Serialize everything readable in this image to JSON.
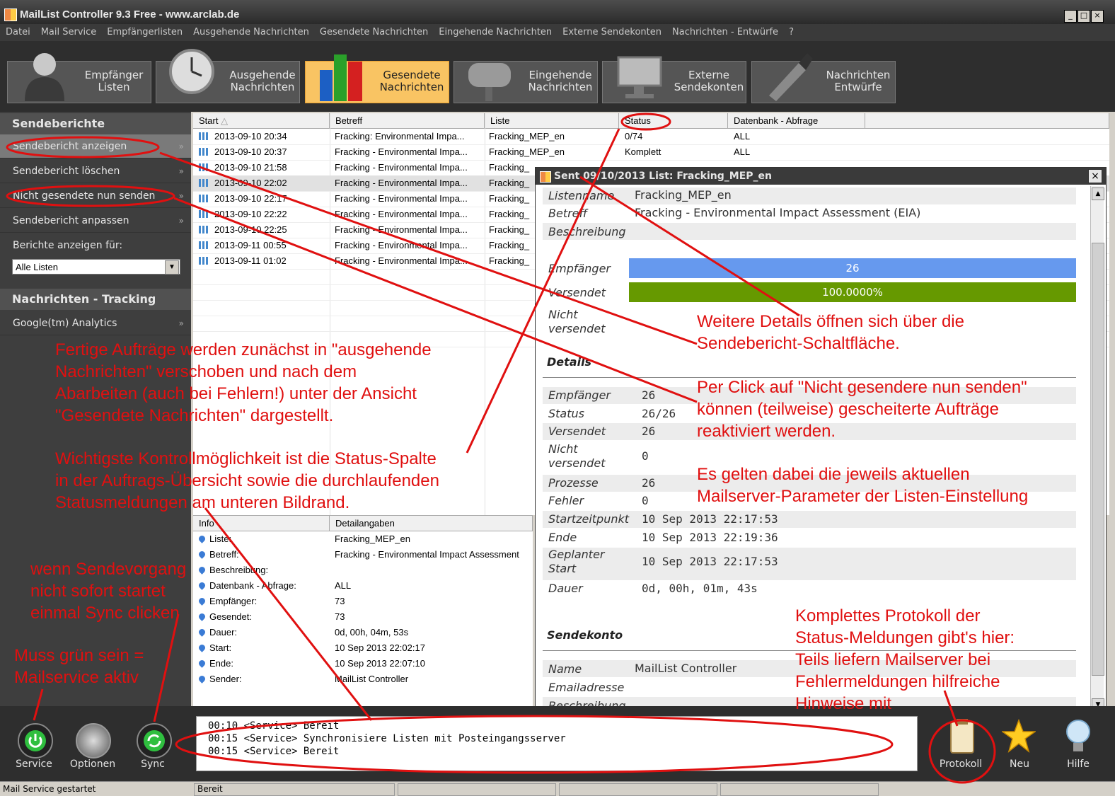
{
  "window": {
    "title": "MailList Controller 9.3 Free - www.arclab.de",
    "btn_min": "_",
    "btn_max": "□",
    "btn_close": "×"
  },
  "menu": [
    "Datei",
    "Mail Service",
    "Empfängerlisten",
    "Ausgehende Nachrichten",
    "Gesendete Nachrichten",
    "Eingehende Nachrichten",
    "Externe Sendekonten",
    "Nachrichten - Entwürfe",
    "?"
  ],
  "toolbar": [
    {
      "line1": "Empfänger",
      "line2": "Listen"
    },
    {
      "line1": "Ausgehende",
      "line2": "Nachrichten"
    },
    {
      "line1": "Gesendete",
      "line2": "Nachrichten",
      "active": true
    },
    {
      "line1": "Eingehende",
      "line2": "Nachrichten"
    },
    {
      "line1": "Externe",
      "line2": "Sendekonten"
    },
    {
      "line1": "Nachrichten",
      "line2": "Entwürfe"
    }
  ],
  "sidebar": {
    "section1": "Sendeberichte",
    "items": [
      "Sendebericht anzeigen",
      "Sendebericht löschen",
      "Nicht gesendete nun senden",
      "Sendebericht anpassen"
    ],
    "arrow": "»",
    "filter_label": "Berichte anzeigen für:",
    "filter_value": "Alle Listen",
    "section2": "Nachrichten - Tracking",
    "tracking_item": "Google(tm) Analytics"
  },
  "grid": {
    "headers": [
      "Start",
      "Betreff",
      "Liste",
      "Status",
      "Datenbank - Abfrage"
    ],
    "sort_indicator": "△",
    "rows": [
      {
        "start": "2013-09-10 20:34",
        "betreff": "Fracking: Environmental Impa...",
        "liste": "Fracking_MEP_en",
        "status": "0/74",
        "db": "ALL"
      },
      {
        "start": "2013-09-10 20:37",
        "betreff": "Fracking - Environmental Impa...",
        "liste": "Fracking_MEP_en",
        "status": "Komplett",
        "db": "ALL"
      },
      {
        "start": "2013-09-10 21:58",
        "betreff": "Fracking - Environmental Impa...",
        "liste": "Fracking_",
        "status": "",
        "db": ""
      },
      {
        "start": "2013-09-10 22:02",
        "betreff": "Fracking - Environmental Impa...",
        "liste": "Fracking_",
        "status": "",
        "db": ""
      },
      {
        "start": "2013-09-10 22:17",
        "betreff": "Fracking - Environmental Impa...",
        "liste": "Fracking_",
        "status": "",
        "db": ""
      },
      {
        "start": "2013-09-10 22:22",
        "betreff": "Fracking - Environmental Impa...",
        "liste": "Fracking_",
        "status": "",
        "db": ""
      },
      {
        "start": "2013-09-10 22:25",
        "betreff": "Fracking - Environmental Impa...",
        "liste": "Fracking_",
        "status": "",
        "db": ""
      },
      {
        "start": "2013-09-11 00:55",
        "betreff": "Fracking - Environmental Impa...",
        "liste": "Fracking_",
        "status": "",
        "db": ""
      },
      {
        "start": "2013-09-11 01:02",
        "betreff": "Fracking - Environmental Impa...",
        "liste": "Fracking_",
        "status": "",
        "db": ""
      }
    ],
    "selected_row": 3
  },
  "info": {
    "headers": [
      "Info",
      "Detailangaben"
    ],
    "rows": [
      {
        "k": "Liste:",
        "v": "Fracking_MEP_en"
      },
      {
        "k": "Betreff:",
        "v": "Fracking - Environmental Impact Assessment"
      },
      {
        "k": "Beschreibung:",
        "v": ""
      },
      {
        "k": "Datenbank - Abfrage:",
        "v": "ALL"
      },
      {
        "k": "Empfänger:",
        "v": "73"
      },
      {
        "k": "Gesendet:",
        "v": "73"
      },
      {
        "k": "Dauer:",
        "v": "0d, 00h, 04m, 53s"
      },
      {
        "k": "Start:",
        "v": "10 Sep 2013 22:02:17"
      },
      {
        "k": "Ende:",
        "v": "10 Sep 2013 22:07:10"
      },
      {
        "k": "Sender:",
        "v": "MailList Controller"
      }
    ]
  },
  "popup": {
    "title": "Sent 09/10/2013 List: Fracking_MEP_en",
    "close": "×",
    "listenname_k": "Listenname",
    "listenname_v": "Fracking_MEP_en",
    "betreff_k": "Betreff",
    "betreff_v": "Fracking - Environmental Impact Assessment (EIA)",
    "beschreibung_k": "Beschreibung",
    "empf_bar_k": "Empfänger",
    "empf_bar_v": "26",
    "vers_bar_k": "Versendet",
    "vers_bar_v": "100.0000%",
    "vers_fraction": 1.0,
    "nicht_k": "Nicht versendet",
    "details_title": "Details",
    "details": [
      {
        "k": "Empfänger",
        "v": "26"
      },
      {
        "k": "Status",
        "v": "26/26"
      },
      {
        "k": "Versendet",
        "v": "26"
      },
      {
        "k": "Nicht versendet",
        "v": "0"
      },
      {
        "k": "Prozesse",
        "v": "26"
      },
      {
        "k": "Fehler",
        "v": "0"
      },
      {
        "k": "Startzeitpunkt",
        "v": "10 Sep 2013 22:17:53"
      },
      {
        "k": "Ende",
        "v": "10 Sep 2013 22:19:36"
      },
      {
        "k": "Geplanter Start",
        "v": "10 Sep 2013 22:17:53"
      },
      {
        "k": "Dauer",
        "v": "0d, 00h, 01m, 43s"
      }
    ],
    "sendekonto_title": "Sendekonto",
    "name_k": "Name",
    "name_v": "MailList Controller",
    "email_k": "Emailadresse",
    "beschr2_k": "Beschreibung"
  },
  "bottom": {
    "service": "Service",
    "optionen": "Optionen",
    "sync": "Sync",
    "log": [
      "00:10 <Service> Bereit",
      "00:15 <Service> Synchronisiere Listen mit Posteingangsserver",
      "00:15 <Service> Bereit"
    ],
    "protokoll": "Protokoll",
    "neu": "Neu",
    "hilfe": "Hilfe"
  },
  "statusbar": {
    "left": "Mail Service gestartet",
    "middle": "Bereit"
  },
  "annotations": {
    "a1": [
      "Fertige Aufträge werden zunächst in \"ausgehende",
      "Nachrichten\" verschoben und nach dem",
      "Abarbeiten (auch bei Fehlern!) unter der Ansicht",
      "\"Gesendete Nachrichten\" dargestellt."
    ],
    "a2": [
      "Wichtigste Kontrollmöglichkeit ist die Status-Spalte",
      "in der Auftrags-Übersicht sowie die durchlaufenden",
      "Statusmeldungen am unteren Bildrand."
    ],
    "a3": [
      "wenn Sendevorgang",
      "nicht sofort startet",
      "einmal Sync clicken"
    ],
    "a4": [
      "Muss grün sein =",
      "Mailservice aktiv"
    ],
    "a5": [
      "Weitere Details öffnen sich über die",
      "Sendebericht-Schaltfläche."
    ],
    "a6": [
      "Per Click auf \"Nicht gesendere nun senden\"",
      "können (teilweise) gescheiterte Aufträge",
      "reaktiviert werden."
    ],
    "a7": [
      "Es gelten dabei die jeweils aktuellen",
      "Mailserver-Parameter der Listen-Einstellung"
    ],
    "a8": [
      "Komplettes Protokoll der",
      "Status-Meldungen gibt's hier:",
      "Teils liefern Mailserver bei",
      "Fehlermeldungen hilfreiche",
      "Hinweise mit"
    ]
  },
  "colors": {
    "accent_active": "#f9c463",
    "bar_blue": "#6699ee",
    "bar_green": "#669900",
    "annotation_red": "#e01010",
    "service_green": "#2fbf3f"
  }
}
